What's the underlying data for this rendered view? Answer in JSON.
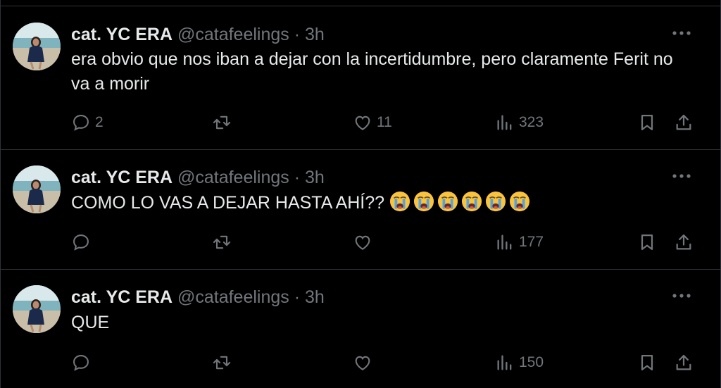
{
  "tweets": [
    {
      "name": "cat. YC ERA",
      "handle": "@catafeelings",
      "dot": "·",
      "time": "3h",
      "text": "era obvio que nos iban a dejar con la incertidumbre, pero claramente Ferit no va a morir",
      "emoji_count": 0,
      "replies": "2",
      "retweets": "",
      "likes": "11",
      "views": "323"
    },
    {
      "name": "cat. YC ERA",
      "handle": "@catafeelings",
      "dot": "·",
      "time": "3h",
      "text": "COMO LO VAS A DEJAR HASTA AHÍ??",
      "emoji": "loudly-crying-face",
      "emoji_count": 6,
      "replies": "",
      "retweets": "",
      "likes": "",
      "views": "177"
    },
    {
      "name": "cat. YC ERA",
      "handle": "@catafeelings",
      "dot": "·",
      "time": "3h",
      "text": "QUE",
      "emoji_count": 0,
      "replies": "",
      "retweets": "",
      "likes": "",
      "views": "150"
    }
  ],
  "icons": {
    "reply": "reply-icon",
    "retweet": "retweet-icon",
    "like": "heart-icon",
    "views": "views-chart-icon",
    "bookmark": "bookmark-icon",
    "share": "share-icon",
    "more": "more-icon"
  },
  "colors": {
    "background": "#000000",
    "text": "#e7e9ea",
    "muted": "#71767b",
    "divider": "#2f3336"
  }
}
